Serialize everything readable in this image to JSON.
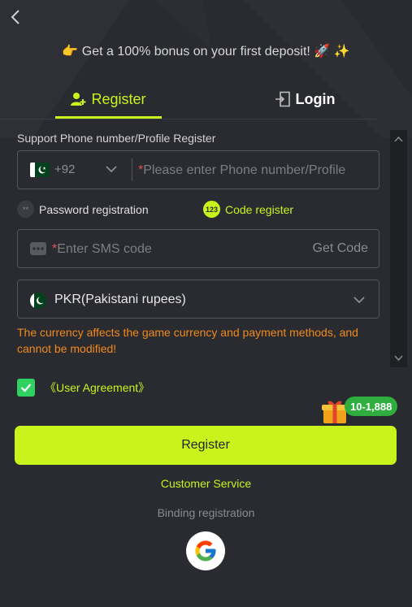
{
  "promo": {
    "text": "👉 Get a 100% bonus on your first deposit! 🚀 ✨"
  },
  "tabs": {
    "register": "Register",
    "login": "Login"
  },
  "phone": {
    "label": "Support Phone number/Profile Register",
    "country_code": "+92",
    "required_mark": "*",
    "placeholder": "Please enter Phone number/Profile"
  },
  "options": {
    "password": "Password registration",
    "code": "Code register",
    "code_badge": "123",
    "password_badge": "**"
  },
  "sms": {
    "required_mark": "*",
    "placeholder": "Enter SMS code",
    "get_code": "Get Code"
  },
  "currency": {
    "selected": "PKR(Pakistani rupees)",
    "warning": "The currency affects the game currency and payment methods, and cannot be modified!"
  },
  "agreement": {
    "label": "《User Agreement》",
    "checked": true
  },
  "gift": {
    "badge": "10-1,888"
  },
  "actions": {
    "register": "Register",
    "customer_service": "Customer Service",
    "binding": "Binding registration"
  },
  "colors": {
    "accent": "#c9f31d",
    "background": "#2a2b30",
    "warning": "#f08a1d",
    "check": "#2fd160"
  },
  "icons": {
    "back": "chevron-left-icon",
    "register_tab": "user-add-icon",
    "login_tab": "login-door-icon",
    "country_flag": "pakistan-flag-icon",
    "sms": "message-dots-icon",
    "google": "google-icon",
    "gift": "gift-box-icon"
  }
}
